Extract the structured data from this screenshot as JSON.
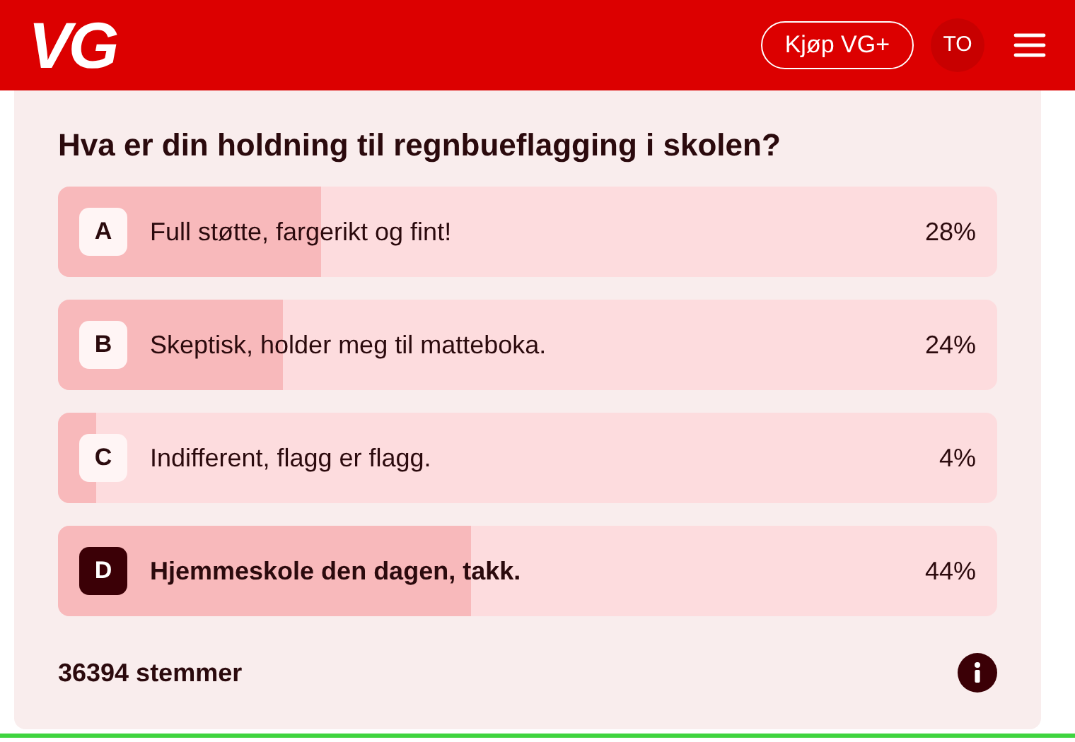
{
  "header": {
    "logo": "VG",
    "buy_button": "Kjøp VG+",
    "avatar": "TO"
  },
  "poll": {
    "question": "Hva er din holdning til regnbueflagging i skolen?",
    "options": [
      {
        "letter": "A",
        "label": "Full støtte, fargerikt og fint!",
        "percent": "28%",
        "level": 0.28,
        "selected": false
      },
      {
        "letter": "B",
        "label": "Skeptisk, holder meg til matteboka.",
        "percent": "24%",
        "level": 0.24,
        "selected": false
      },
      {
        "letter": "C",
        "label": "Indifferent, flagg er flagg.",
        "percent": "4%",
        "level": 0.04,
        "selected": false
      },
      {
        "letter": "D",
        "label": "Hjemmeskole den dagen, takk.",
        "percent": "44%",
        "level": 0.44,
        "selected": true
      }
    ],
    "votes": "36394 stemmer"
  }
}
